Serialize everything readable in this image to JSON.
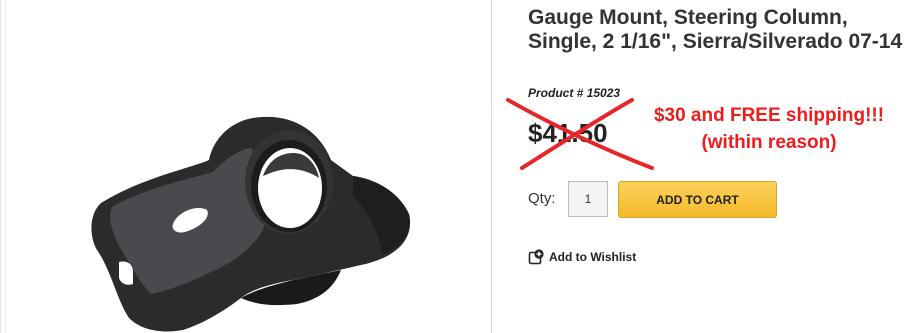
{
  "product": {
    "title": "Gauge Mount, Steering Column, Single, 2 1/16\", Sierra/Silverado 07-14",
    "sku_label": "Product #",
    "sku_value": "15023",
    "old_price": "$41.50",
    "promo_line_1": "$30 and FREE shipping!!!",
    "promo_line_2": "(within reason)"
  },
  "purchase": {
    "qty_label": "Qty:",
    "qty_value": "1",
    "add_to_cart_label": "ADD TO CART"
  },
  "wishlist": {
    "label": "Add to Wishlist"
  },
  "icons": {
    "wishlist": "wishlist-add-icon",
    "strike": "red-cross-mark"
  },
  "colors": {
    "promo": "#ee1c1c",
    "cross": "#e8262a",
    "button": "#f5b92a"
  }
}
